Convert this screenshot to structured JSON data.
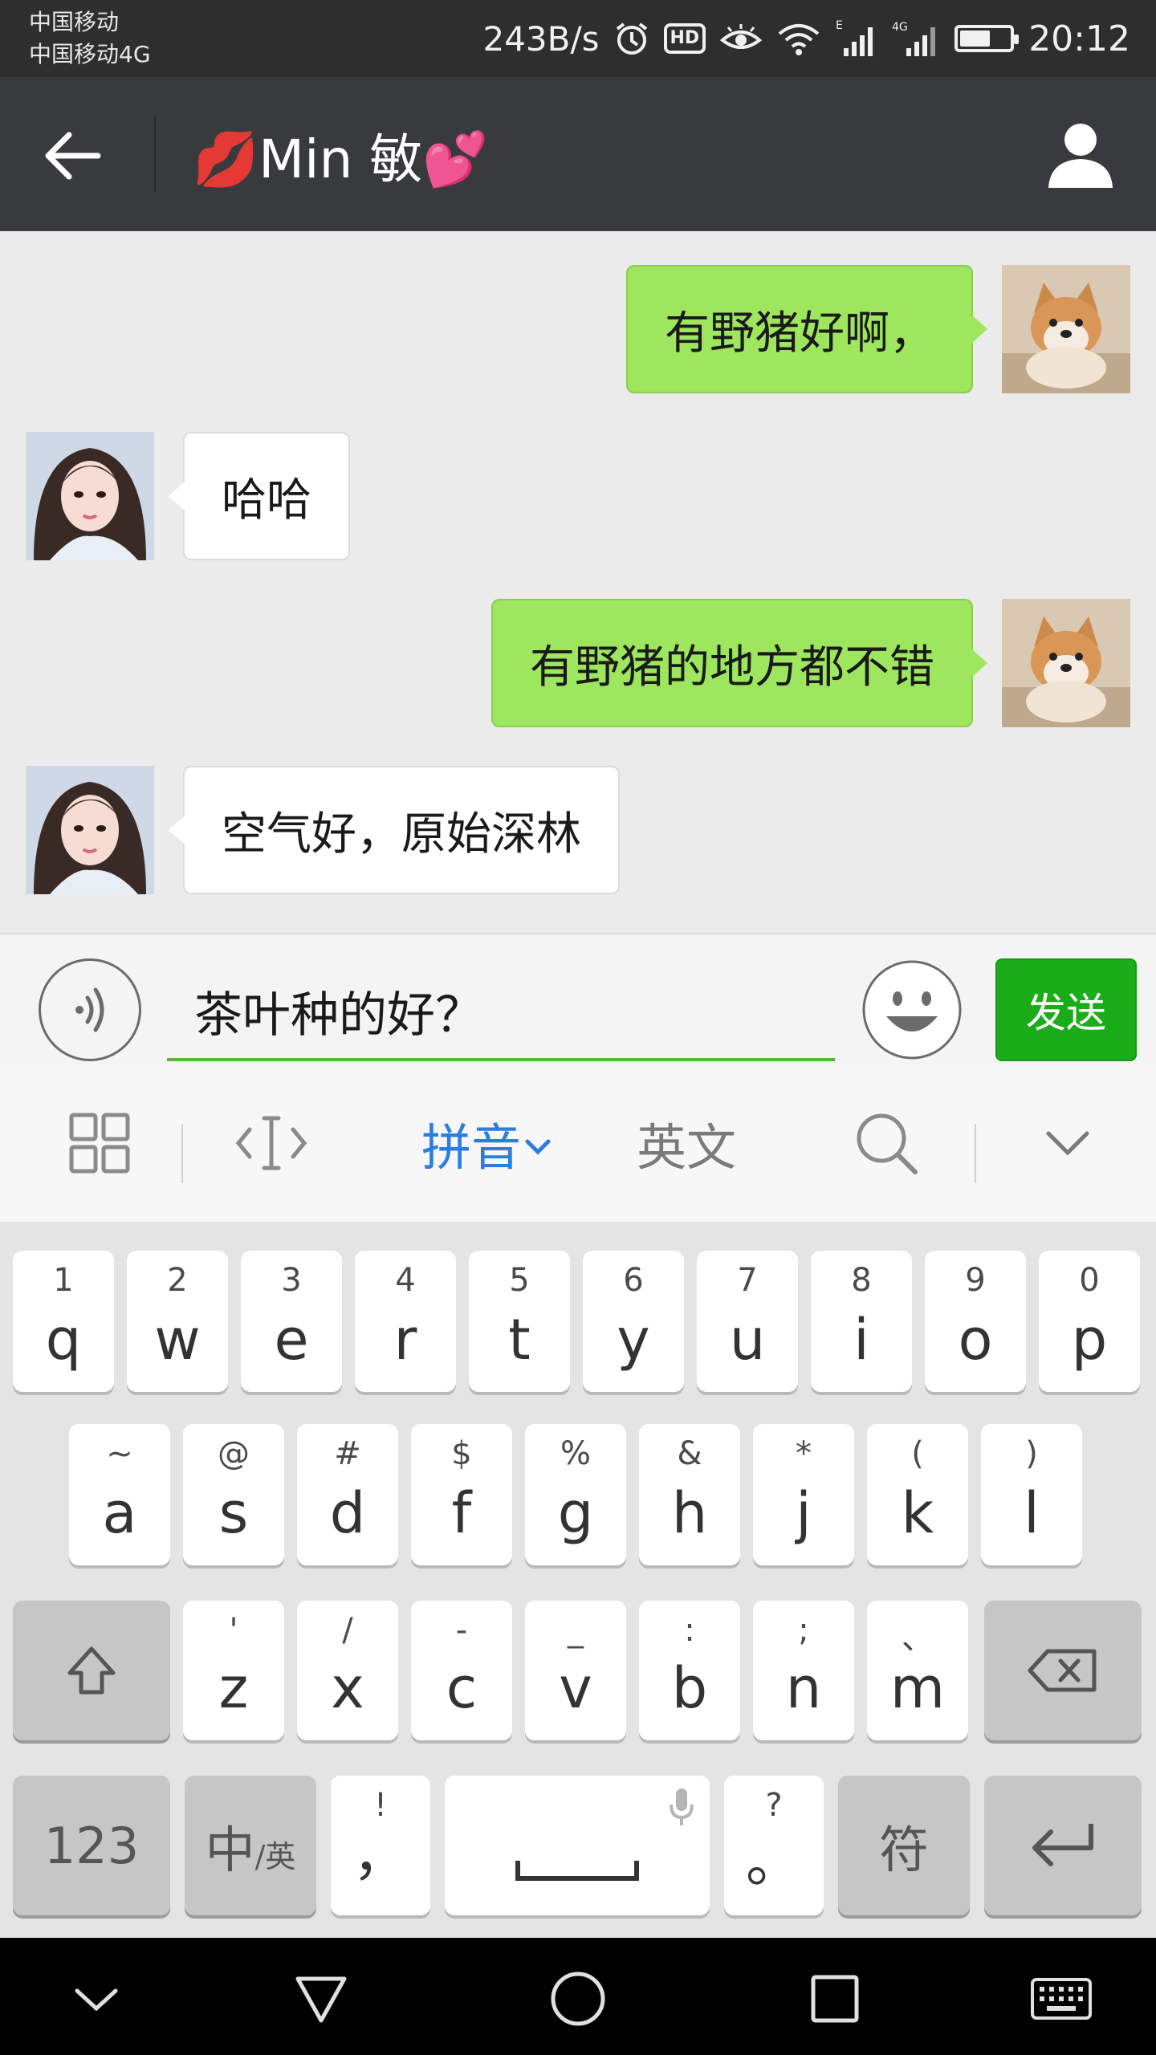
{
  "status_bar": {
    "carrier_1": "中国移动",
    "carrier_2": "中国移动4G",
    "net_speed": "243B/s",
    "hd_badge": "HD",
    "time": "20:12",
    "battery_level": 0.6
  },
  "title_bar": {
    "title": "💋Min 敏💕"
  },
  "messages": [
    {
      "side": "me",
      "text": "有野猪好啊，"
    },
    {
      "side": "them",
      "text": "哈哈"
    },
    {
      "side": "me",
      "text": "有野猪的地方都不错"
    },
    {
      "side": "them",
      "text": "空气好，原始深林"
    }
  ],
  "input_bar": {
    "value": "茶叶种的好？",
    "send_label": "发送"
  },
  "ime_toolbar": {
    "pinyin_label": "拼音",
    "english_label": "英文"
  },
  "keyboard": {
    "row1": [
      {
        "main": "q",
        "sub": "1"
      },
      {
        "main": "w",
        "sub": "2"
      },
      {
        "main": "e",
        "sub": "3"
      },
      {
        "main": "r",
        "sub": "4"
      },
      {
        "main": "t",
        "sub": "5"
      },
      {
        "main": "y",
        "sub": "6"
      },
      {
        "main": "u",
        "sub": "7"
      },
      {
        "main": "i",
        "sub": "8"
      },
      {
        "main": "o",
        "sub": "9"
      },
      {
        "main": "p",
        "sub": "0"
      }
    ],
    "row2": [
      {
        "main": "a",
        "sub": "~"
      },
      {
        "main": "s",
        "sub": "@"
      },
      {
        "main": "d",
        "sub": "#"
      },
      {
        "main": "f",
        "sub": "$"
      },
      {
        "main": "g",
        "sub": "%"
      },
      {
        "main": "h",
        "sub": "&"
      },
      {
        "main": "j",
        "sub": "*"
      },
      {
        "main": "k",
        "sub": "("
      },
      {
        "main": "l",
        "sub": ")"
      }
    ],
    "row3": [
      {
        "main": "z",
        "sub": "'"
      },
      {
        "main": "x",
        "sub": "/"
      },
      {
        "main": "c",
        "sub": "-"
      },
      {
        "main": "v",
        "sub": "_"
      },
      {
        "main": "b",
        "sub": ":"
      },
      {
        "main": "n",
        "sub": ";"
      },
      {
        "main": "m",
        "sub": "、"
      }
    ],
    "numbers_label": "123",
    "lang_main": "中",
    "lang_sub": "/英",
    "comma_main": "，",
    "comma_sub": "!",
    "period_main": "。",
    "period_sub": "?",
    "symbols_label": "符"
  },
  "colors": {
    "title_bar": "#393a3e",
    "my_bubble": "#9ee65e",
    "send_button": "#1aad19",
    "ime_active": "#2b7de0"
  }
}
